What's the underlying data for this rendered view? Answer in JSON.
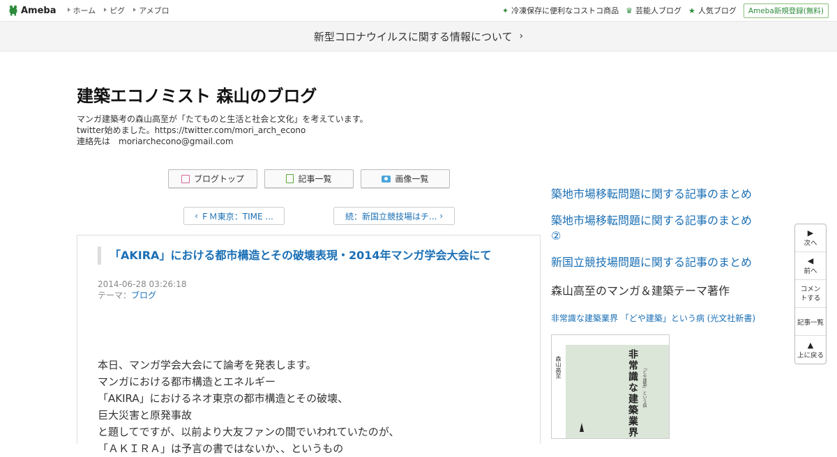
{
  "topnav": {
    "logo": "Ameba",
    "left_links": [
      "ホーム",
      "ピグ",
      "アメブロ"
    ],
    "right_links": [
      "冷凍保存に便利なコストコ商品",
      "芸能人ブログ",
      "人気ブログ"
    ],
    "register": "Ameba新規登録(無料)"
  },
  "banner": {
    "text": "新型コロナウイルスに関する情報について"
  },
  "blog": {
    "title": "建築エコノミスト 森山のブログ",
    "desc1": "マンガ建築考の森山高至が「たてものと生活と社会と文化」を考えています。",
    "desc2": "twitter始めました。https://twitter.com/mori_arch_econo",
    "desc3": "連絡先は　moriarchecono@gmail.com"
  },
  "buttons": {
    "top": "ブログトップ",
    "list": "記事一覧",
    "images": "画像一覧"
  },
  "pager": {
    "prev": "ＦＭ東京：TIME ...",
    "next": "続：新国立競技場はチ..."
  },
  "article": {
    "title": "「AKIRA」における都市構造とその破壊表現・2014年マンガ学会大会にて",
    "date": "2014-06-28 03:26:18",
    "theme_label": "テーマ：",
    "theme": "ブログ",
    "body": [
      "本日、マンガ学会大会にて論考を発表します。",
      "マンガにおける都市構造とエネルギー",
      "「AKIRA」におけるネオ東京の都市構造とその破壊、",
      "巨大災害と原発事故",
      "と題してですが、以前より大友ファンの間でいわれていたのが、",
      "「ＡＫＩＲＡ」は予言の書ではないか、、というもの"
    ]
  },
  "sidebar": {
    "links": [
      "築地市場移転問題に関する記事のまとめ",
      "築地市場移転問題に関する記事のまとめ②",
      "新国立競技場問題に関する記事のまとめ"
    ],
    "heading": "森山高至のマンガ＆建築テーマ著作",
    "book_link": "非常識な建築業界 「どや建築」という病 (光文社新書)",
    "book_title": "非常識な建築業界",
    "book_sub": "「どや建築」という病",
    "book_author": "森山高至"
  },
  "float_nav": {
    "next": "次へ",
    "prev": "前へ",
    "comment": "コメントする",
    "list": "記事一覧",
    "top": "上に戻る"
  },
  "colors": {
    "link": "#1a6fb5",
    "ameba_green": "#2d8c3c"
  }
}
